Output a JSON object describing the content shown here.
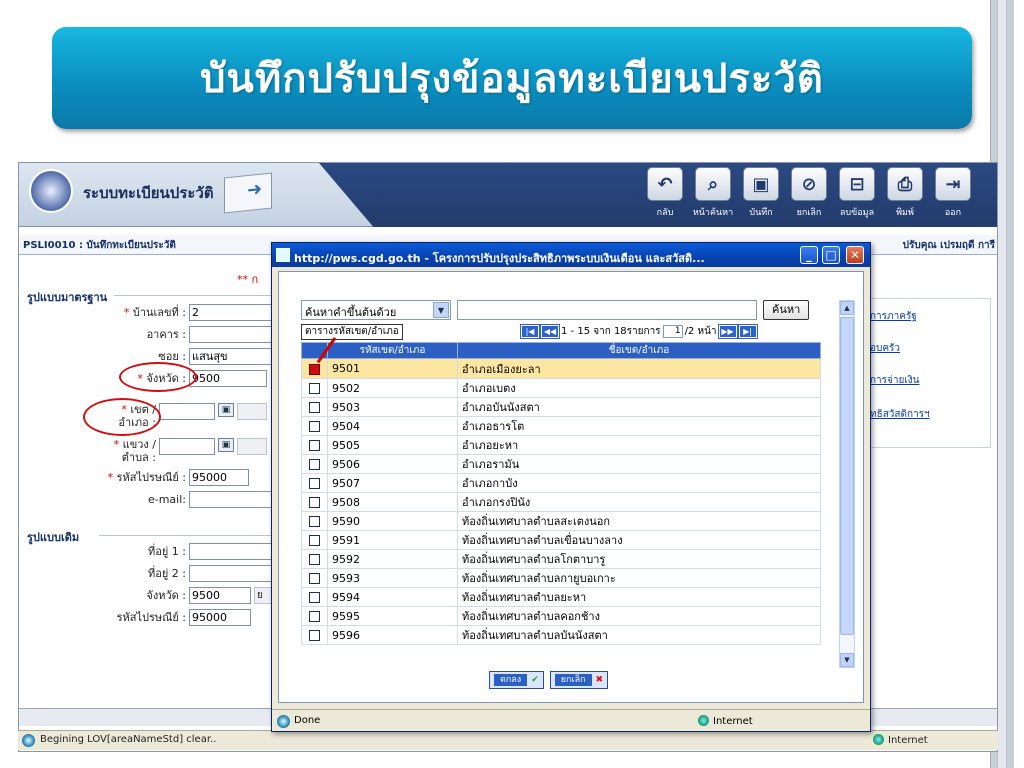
{
  "slide_title": "บันทึกปรับปรุงข้อมูลทะเบียนประวัติ",
  "app": {
    "name": "ระบบทะเบียนประวัติ",
    "page_id": "PSLI0010 : บันทึกทะเบียนประวัติ",
    "user_fragment": "ปรับคุณ เปรมฤดี การี",
    "required_note": "** ก",
    "toolbar": [
      {
        "name": "back",
        "label": "กลับ",
        "glyph": "↶"
      },
      {
        "name": "search-page",
        "label": "หน้าค้นหา",
        "glyph": "⌕"
      },
      {
        "name": "save",
        "label": "บันทึก",
        "glyph": "▣"
      },
      {
        "name": "cancel",
        "label": "ยกเลิก",
        "glyph": "⊘"
      },
      {
        "name": "delete",
        "label": "ลบข้อมูล",
        "glyph": "⊟"
      },
      {
        "name": "print",
        "label": "พิมพ์",
        "glyph": "⎙"
      },
      {
        "name": "exit",
        "label": "ออก",
        "glyph": "⇥"
      }
    ],
    "side_links": [
      "การภาครัฐ",
      "อบครัว",
      "การจ่ายเงิน",
      "ทธิสวัสดิการฯ"
    ]
  },
  "form": {
    "standard_group": "รูปแบบมาตรฐาน",
    "house_no": {
      "label": "บ้านเลขที่ :",
      "value": "2"
    },
    "building": {
      "label": "อาคาร :",
      "value": ""
    },
    "soi": {
      "label": "ซอย :",
      "value": "แสนสุข"
    },
    "province": {
      "label": "จังหวัด :",
      "value": "9500"
    },
    "district": {
      "label1": "เขต /",
      "label2": "อำเภอ :",
      "value": ""
    },
    "subdistrict": {
      "label1": "แขวง /",
      "label2": "ตำบล :",
      "value": ""
    },
    "postal": {
      "label": "รหัสไปรษณีย์ :",
      "value": "95000"
    },
    "email": {
      "label": "e-mail:",
      "value": ""
    },
    "old_group": "รูปแบบเดิม",
    "addr1": {
      "label": "ที่อยู่ 1 :",
      "value": ""
    },
    "addr2": {
      "label": "ที่อยู่ 2 :",
      "value": ""
    },
    "old_province": {
      "label": "จังหวัด :",
      "value": "9500",
      "suffix": "ย"
    },
    "old_postal": {
      "label": "รหัสไปรษณีย์ :",
      "value": "95000"
    }
  },
  "browser_status": {
    "message": "Begining LOV[areaNameStd] clear..",
    "zone": "Internet"
  },
  "popup": {
    "title": "http://pws.cgd.go.th - โครงการปรับปรุงประสิทธิภาพระบบเงินเดือน และสวัสดิ...",
    "search_mode": "ค้นหาคำขึ้นต้นด้วย",
    "search_value": "",
    "search_button": "ค้นหา",
    "table_title": "ตารางรหัสเขต/อำเภอ",
    "pager_prefix": "1 - 15 จาก 18รายการ",
    "pager_page": "1",
    "pager_suffix": "/2 หน้า",
    "columns": [
      "รหัสเขต/อำเภอ",
      "ชื่อเขต/อำเภอ"
    ],
    "rows": [
      {
        "code": "9501",
        "name": "อำเภอเมืองยะลา",
        "checked": true
      },
      {
        "code": "9502",
        "name": "อำเภอเบตง",
        "checked": false
      },
      {
        "code": "9503",
        "name": "อำเภอบันนังสตา",
        "checked": false
      },
      {
        "code": "9504",
        "name": "อำเภอธารโต",
        "checked": false
      },
      {
        "code": "9505",
        "name": "อำเภอยะหา",
        "checked": false
      },
      {
        "code": "9506",
        "name": "อำเภอรามัน",
        "checked": false
      },
      {
        "code": "9507",
        "name": "อำเภอกาบัง",
        "checked": false
      },
      {
        "code": "9508",
        "name": "อำเภอกรงปินัง",
        "checked": false
      },
      {
        "code": "9590",
        "name": "ท้องถิ่นเทศบาลตำบลสะเตงนอก",
        "checked": false
      },
      {
        "code": "9591",
        "name": "ท้องถิ่นเทศบาลตำบลเขื่อนบางลาง",
        "checked": false
      },
      {
        "code": "9592",
        "name": "ท้องถิ่นเทศบาลตำบลโกตาบารู",
        "checked": false
      },
      {
        "code": "9593",
        "name": "ท้องถิ่นเทศบาลตำบลกายูบอเกาะ",
        "checked": false
      },
      {
        "code": "9594",
        "name": "ท้องถิ่นเทศบาลตำบลยะหา",
        "checked": false
      },
      {
        "code": "9595",
        "name": "ท้องถิ่นเทศบาลตำบลคอกช้าง",
        "checked": false
      },
      {
        "code": "9596",
        "name": "ท้องถิ่นเทศบาลตำบลบันนังสตา",
        "checked": false
      }
    ],
    "ok_label": "ตกลง",
    "cancel_label": "ยกเลิก",
    "status": "Done",
    "zone": "Internet"
  }
}
